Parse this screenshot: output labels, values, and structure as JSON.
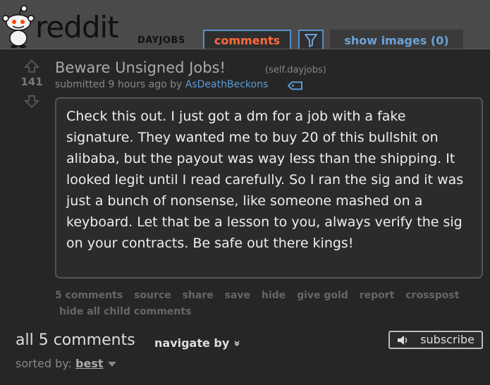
{
  "header": {
    "logo_text": "reddit",
    "subreddit": "DAYJOBS",
    "tabs": [
      {
        "label": "comments",
        "active": true
      },
      {
        "label": "show images (0)"
      }
    ],
    "filter_icon": "filter-icon"
  },
  "post": {
    "score": "141",
    "title": "Beware Unsigned Jobs!",
    "domain": "(self.dayjobs)",
    "submitted_prefix": "submitted 9 hours ago by",
    "author": "AsDeathBeckons",
    "selftext": "Check this out. I just got a dm for a job with a fake signature. They wanted me to buy 20 of this bullshit on alibaba, but the payout was way less than the shipping. It looked legit until I read carefully. So I ran the sig and it was just a bunch of nonsense, like someone mashed on a keyboard. Let that be a lesson to you, always verify the sig on your contracts. Be safe out there kings!",
    "buttons": [
      "5 comments",
      "source",
      "share",
      "save",
      "hide",
      "give gold",
      "report",
      "crosspost"
    ],
    "hide_children": "hide all child comments"
  },
  "comments_area": {
    "title": "all 5 comments",
    "navigate": "navigate by",
    "subscribe": "subscribe",
    "sorted_label": "sorted by:",
    "sorted_value": "best"
  },
  "colors": {
    "background": "#262626",
    "header": "#4a4a4a",
    "active_tab": "#ff6a3c",
    "link": "#5b9bd5"
  }
}
